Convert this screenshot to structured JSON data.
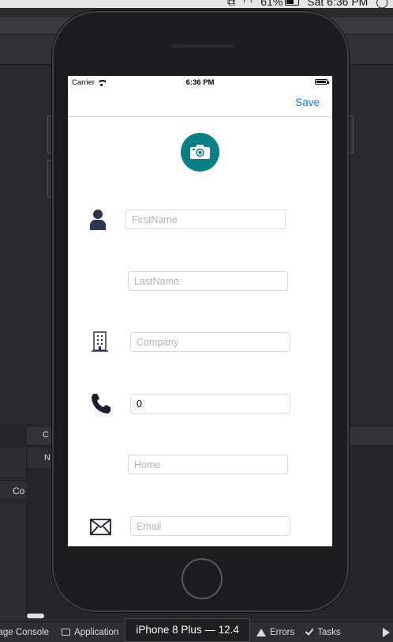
{
  "menubar": {
    "battery_percent": "61%",
    "clock": "Sat 6:36 PM"
  },
  "ide": {
    "bottom_panel_title": "C",
    "bottom_panel_sub": "N",
    "bottom_panel_left": "Co",
    "statusbar": {
      "package_console": "ckage Console",
      "application": "Application",
      "device": "iPhone 8 Plus — 12.4",
      "errors": "Errors",
      "tasks": "Tasks"
    }
  },
  "device": {
    "statusbar": {
      "carrier": "Carrier",
      "time": "6:36 PM"
    },
    "navbar": {
      "save_label": "Save"
    },
    "form": {
      "first_name_placeholder": "FirstName",
      "last_name_placeholder": "LastName",
      "company_placeholder": "Company",
      "phone_value": "0",
      "home_placeholder": "Home",
      "email_placeholder": "Email"
    }
  },
  "colors": {
    "accent_teal": "#0b7f86",
    "ios_blue": "#0a7aff",
    "icon_navy": "#2d3350"
  },
  "icons": [
    "camera-icon",
    "person-icon",
    "building-icon",
    "phone-icon",
    "envelope-icon",
    "wifi-icon",
    "battery-icon"
  ]
}
